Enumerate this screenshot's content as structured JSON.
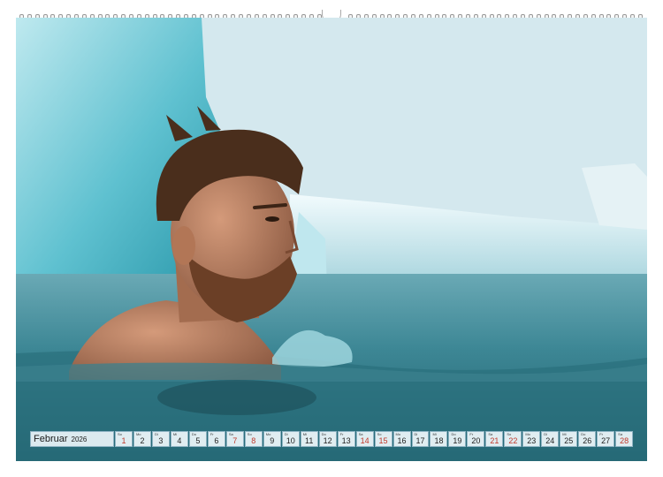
{
  "calendar": {
    "month": "Februar",
    "year": "2026",
    "days": [
      {
        "wd": "So",
        "num": "1",
        "weekend": true
      },
      {
        "wd": "Mo",
        "num": "2",
        "weekend": false
      },
      {
        "wd": "Di",
        "num": "3",
        "weekend": false
      },
      {
        "wd": "Mi",
        "num": "4",
        "weekend": false
      },
      {
        "wd": "Do",
        "num": "5",
        "weekend": false
      },
      {
        "wd": "Fr",
        "num": "6",
        "weekend": false
      },
      {
        "wd": "Sa",
        "num": "7",
        "weekend": true
      },
      {
        "wd": "So",
        "num": "8",
        "weekend": true
      },
      {
        "wd": "Mo",
        "num": "9",
        "weekend": false
      },
      {
        "wd": "Di",
        "num": "10",
        "weekend": false
      },
      {
        "wd": "Mi",
        "num": "11",
        "weekend": false
      },
      {
        "wd": "Do",
        "num": "12",
        "weekend": false
      },
      {
        "wd": "Fr",
        "num": "13",
        "weekend": false
      },
      {
        "wd": "Sa",
        "num": "14",
        "weekend": true
      },
      {
        "wd": "So",
        "num": "15",
        "weekend": true
      },
      {
        "wd": "Mo",
        "num": "16",
        "weekend": false
      },
      {
        "wd": "Di",
        "num": "17",
        "weekend": false
      },
      {
        "wd": "Mi",
        "num": "18",
        "weekend": false
      },
      {
        "wd": "Do",
        "num": "19",
        "weekend": false
      },
      {
        "wd": "Fr",
        "num": "20",
        "weekend": false
      },
      {
        "wd": "Sa",
        "num": "21",
        "weekend": true
      },
      {
        "wd": "So",
        "num": "22",
        "weekend": true
      },
      {
        "wd": "Mo",
        "num": "23",
        "weekend": false
      },
      {
        "wd": "Di",
        "num": "24",
        "weekend": false
      },
      {
        "wd": "Mi",
        "num": "25",
        "weekend": false
      },
      {
        "wd": "Do",
        "num": "26",
        "weekend": false
      },
      {
        "wd": "Fr",
        "num": "27",
        "weekend": false
      },
      {
        "wd": "Sa",
        "num": "28",
        "weekend": true
      }
    ]
  },
  "colors": {
    "weekend": "#c0392b",
    "water": "#2d6f7d",
    "ice": "#7fd0dc"
  }
}
